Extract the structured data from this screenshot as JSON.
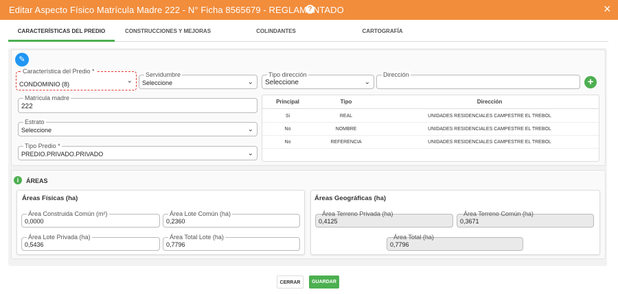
{
  "header": {
    "title": "Editar Aspecto Físico Matrícula Madre 222 - N° Ficha 8565679 - REGLAMENTADO",
    "help": "?",
    "close": "×"
  },
  "tabs": [
    {
      "label": "CARACTERÍSTICAS DEL PREDIO"
    },
    {
      "label": "CONSTRUCCIONES Y MEJORAS"
    },
    {
      "label": "COLINDANTES"
    },
    {
      "label": "CARTOGRAFÍA"
    }
  ],
  "form": {
    "caracteristica": {
      "label": "Característica del Predio *",
      "value": "CONDOMINIO (8)"
    },
    "servidumbre": {
      "label": "Servidumbre",
      "value": "Seleccione"
    },
    "tipo_direccion": {
      "label": "Tipo dirección",
      "value": "Seleccione"
    },
    "direccion": {
      "label": "Dirección",
      "value": ""
    },
    "matricula": {
      "label": "Matrícula madre",
      "value": "222"
    },
    "estrato": {
      "label": "Estrato",
      "value": "Seleccione"
    },
    "tipo_predio": {
      "label": "Tipo Predio *",
      "value": "PREDIO.PRIVADO.PRIVADO"
    },
    "chevron": "⌄",
    "add": "+",
    "edit": "✎"
  },
  "direcciones": {
    "headers": [
      "Principal",
      "Tipo",
      "Dirección"
    ],
    "rows": [
      [
        "Si",
        "REAL",
        "UNIDADES RESIDENCIALES CAMPESTRE EL TREBOL"
      ],
      [
        "No",
        "NOMBRE",
        "UNIDADES RESIDENCIALES CAMPESTRE EL TREBOL"
      ],
      [
        "No",
        "REFERENCIA",
        "UNIDADES RESIDENCIALES CAMPESTRE EL TREBOL"
      ]
    ]
  },
  "areas": {
    "title": "ÁREAS",
    "info": "i",
    "fisicas": {
      "title": "Áreas Físicas (ha)",
      "construida": {
        "label": "Área Construida Común (m²)",
        "value": "0,0000"
      },
      "lote_comun": {
        "label": "Área Lote Común (ha)",
        "value": "0,2360"
      },
      "lote_privada": {
        "label": "Área Lote Privada (ha)",
        "value": "0,5436"
      },
      "total_lote": {
        "label": "Área Total Lote (ha)",
        "value": "0,7796"
      }
    },
    "geograficas": {
      "title": "Áreas Geográficas (ha)",
      "terreno_privada": {
        "label": "Área Terreno Privada (ha)",
        "value": "0,4125"
      },
      "terreno_comun": {
        "label": "Área Terreno Común (ha)",
        "value": "0,3671"
      },
      "total": {
        "label": "Área Total (ha)",
        "value": "0,7796"
      }
    }
  },
  "footer": {
    "cerrar": "CERRAR",
    "guardar": "GUARDAR"
  }
}
